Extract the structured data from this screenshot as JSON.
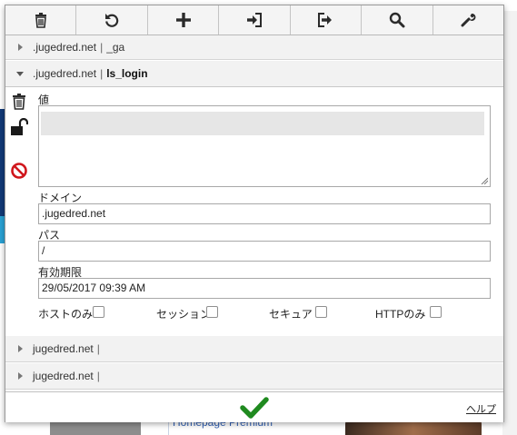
{
  "toolbar": {
    "buttons": [
      {
        "name": "delete-all-button",
        "icon": "trash-icon"
      },
      {
        "name": "refresh-button",
        "icon": "refresh-icon"
      },
      {
        "name": "add-cookie-button",
        "icon": "plus-icon"
      },
      {
        "name": "import-button",
        "icon": "import-icon"
      },
      {
        "name": "export-button",
        "icon": "export-icon"
      },
      {
        "name": "search-button",
        "icon": "search-icon"
      },
      {
        "name": "settings-button",
        "icon": "wrench-icon"
      }
    ]
  },
  "cookies": [
    {
      "domain": ".jugedred.net",
      "separator": "|",
      "name": "_ga",
      "expanded": false
    },
    {
      "domain": ".jugedred.net",
      "separator": "|",
      "name": "ls_login",
      "expanded": true
    },
    {
      "domain": "jugedred.net",
      "separator": "|",
      "name": "",
      "expanded": false
    },
    {
      "domain": "jugedred.net",
      "separator": "|",
      "name": "",
      "expanded": false
    }
  ],
  "editor": {
    "side_icons": [
      "trash-icon",
      "unlock-icon",
      "block-icon"
    ],
    "value_label": "値",
    "value": "",
    "domain_label": "ドメイン",
    "domain_value": ".jugedred.net",
    "path_label": "パス",
    "path_value": "/",
    "expires_label": "有効期限",
    "expires_value": "29/05/2017 09:39 AM",
    "options": [
      {
        "label": "ホストのみ",
        "checked": false
      },
      {
        "label": "セッション",
        "checked": false
      },
      {
        "label": "セキュア",
        "checked": false
      },
      {
        "label": "HTTPのみ",
        "checked": false
      }
    ]
  },
  "footer": {
    "save_icon": "checkmark-icon",
    "help_label": "ヘルプ"
  },
  "background": {
    "banner_text": "Homepage Premium"
  },
  "colors": {
    "accent_green": "#1f8a1f",
    "delete_red": "#d0161c",
    "icon_dark": "#2b2b2b"
  }
}
